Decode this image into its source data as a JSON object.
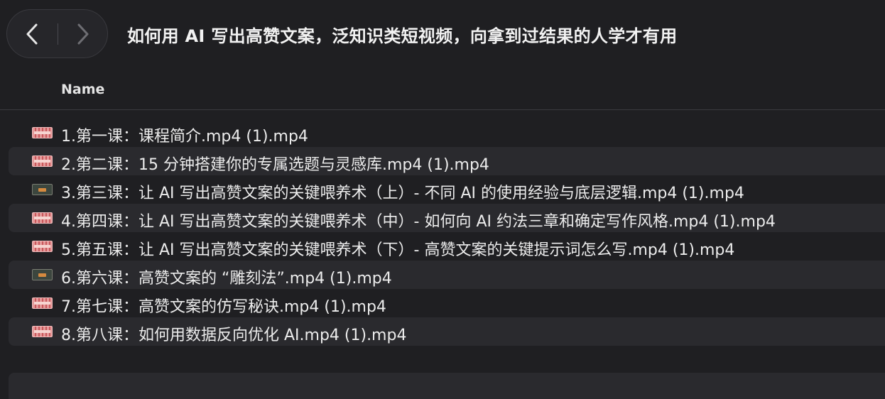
{
  "window": {
    "title": "如何用 AI 写出高赞文案，泛知识类短视频，向拿到过结果的人学才有用"
  },
  "navigation": {
    "back_icon": "chevron-left-icon",
    "forward_icon": "chevron-right-icon"
  },
  "columns": {
    "name_header": "Name"
  },
  "files": [
    {
      "name": "1.第一课：课程简介.mp4 (1).mp4",
      "icon": "video-thumbnail-pink-icon"
    },
    {
      "name": "2.第二课：15 分钟搭建你的专属选题与灵感库.mp4 (1).mp4",
      "icon": "video-thumbnail-pink-icon"
    },
    {
      "name": "3.第三课：让 AI 写出高赞文案的关键喂养术（上）- 不同 AI 的使用经验与底层逻辑.mp4 (1).mp4",
      "icon": "video-thumbnail-dark-icon"
    },
    {
      "name": "4.第四课：让 AI 写出高赞文案的关键喂养术（中）- 如何向 AI 约法三章和确定写作风格.mp4 (1).mp4",
      "icon": "video-thumbnail-pink-icon"
    },
    {
      "name": "5.第五课：让 AI 写出高赞文案的关键喂养术（下）- 高赞文案的关键提示词怎么写.mp4 (1).mp4",
      "icon": "video-thumbnail-pink-icon"
    },
    {
      "name": "6.第六课：高赞文案的 “雕刻法”.mp4 (1).mp4",
      "icon": "video-thumbnail-dark-icon"
    },
    {
      "name": "7.第七课：高赞文案的仿写秘诀.mp4 (1).mp4",
      "icon": "video-thumbnail-pink-icon"
    },
    {
      "name": "8.第八课：如何用数据反向优化 AI.mp4 (1).mp4",
      "icon": "video-thumbnail-pink-icon"
    }
  ]
}
